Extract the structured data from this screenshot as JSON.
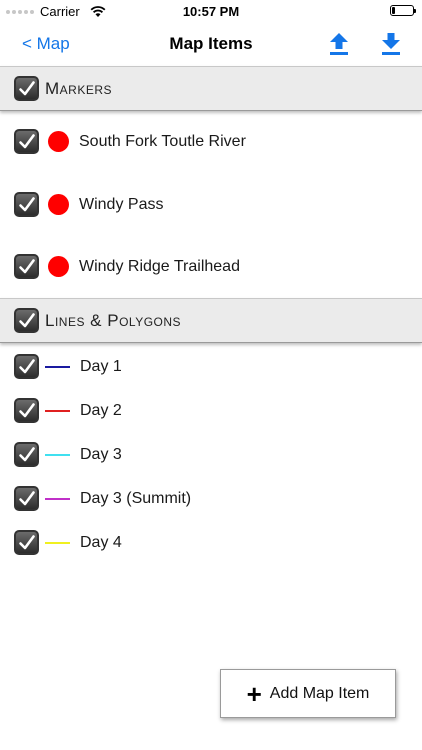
{
  "status_bar": {
    "carrier": "Carrier",
    "time": "10:57 PM"
  },
  "nav": {
    "back_label": "< Map",
    "title": "Map Items"
  },
  "markers_section": {
    "title": "Markers",
    "items": [
      {
        "label": "South Fork Toutle River",
        "color": "#ff0000"
      },
      {
        "label": "Windy Pass",
        "color": "#ff0000"
      },
      {
        "label": "Windy Ridge Trailhead",
        "color": "#ff0000"
      }
    ]
  },
  "lines_section": {
    "title": "Lines & Polygons",
    "items": [
      {
        "label": "Day 1",
        "color": "#1a1aa0"
      },
      {
        "label": "Day 2",
        "color": "#e02020"
      },
      {
        "label": "Day 3",
        "color": "#40e0f0"
      },
      {
        "label": "Day 3 (Summit)",
        "color": "#c030c8"
      },
      {
        "label": "Day 4",
        "color": "#f0f020"
      }
    ]
  },
  "add_button": {
    "label": "Add Map Item"
  },
  "accent_color": "#1476e8"
}
